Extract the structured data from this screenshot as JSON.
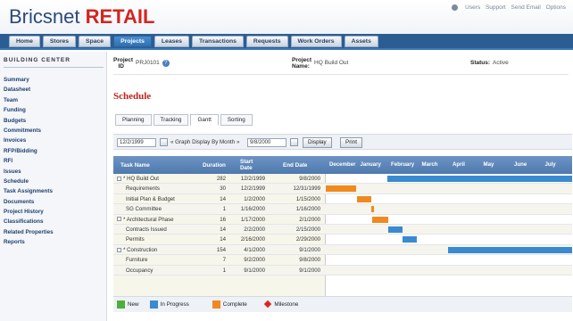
{
  "app": {
    "logo_part1": "Bricsnet",
    "logo_part2": "RETAIL",
    "top_links": [
      "Users",
      "Support",
      "Send Email",
      "Options"
    ]
  },
  "nav_tabs": [
    {
      "label": "Home",
      "active": false
    },
    {
      "label": "Stores",
      "active": false
    },
    {
      "label": "Space",
      "active": false
    },
    {
      "label": "Projects",
      "active": true
    },
    {
      "label": "Leases",
      "active": false
    },
    {
      "label": "Transactions",
      "active": false
    },
    {
      "label": "Requests",
      "active": false
    },
    {
      "label": "Work Orders",
      "active": false
    },
    {
      "label": "Assets",
      "active": false
    }
  ],
  "sidebar": {
    "title": "BUILDING CENTER",
    "items": [
      "Summary",
      "Datasheet",
      "Team",
      "Funding",
      "Budgets",
      "Commitments",
      "Invoices",
      "RFP/Bidding",
      "RFI",
      "Issues",
      "Schedule",
      "Task Assignments",
      "Documents",
      "Project History",
      "Classifications",
      "Related Properties",
      "Reports"
    ]
  },
  "project": {
    "id_label_1": "Project",
    "id_label_2": "ID",
    "id_value": "PRJ0101",
    "name_label_1": "Project",
    "name_label_2": "Name:",
    "name_value": "HQ Build Out",
    "status_label": "Status:",
    "status_value": "Active"
  },
  "schedule": {
    "title": "Schedule",
    "view_tabs": [
      {
        "label": "Planning",
        "active": false
      },
      {
        "label": "Tracking",
        "active": false
      },
      {
        "label": "Gantt",
        "active": true
      },
      {
        "label": "Sorting",
        "active": false
      }
    ],
    "controls": {
      "start_date": "12/2/1999",
      "graph_label": "« Graph Display By Month »",
      "end_date": "9/8/2000",
      "display_button": "Display",
      "print_button": "Print"
    },
    "columns": {
      "task_name": "Task Name",
      "duration": "Duration",
      "start_date": "Start Date",
      "end_date": "End Date"
    },
    "months": [
      "December",
      "January",
      "February",
      "March",
      "April",
      "May",
      "June",
      "July"
    ],
    "tasks": [
      {
        "name": "HQ Build Out",
        "prefix": "* ",
        "indent": 0,
        "duration": "282",
        "start": "12/2/1999",
        "end": "9/8/2000",
        "status": "in_progress",
        "bar_start_day": 61,
        "bar_days": 220
      },
      {
        "name": "Requirements",
        "prefix": "",
        "indent": 1,
        "duration": "30",
        "start": "12/2/1999",
        "end": "12/31/1999",
        "status": "complete",
        "bar_start_day": 0,
        "bar_days": 30
      },
      {
        "name": "Initial Plan & Budget",
        "prefix": "",
        "indent": 1,
        "duration": "14",
        "start": "1/2/2000",
        "end": "1/15/2000",
        "status": "complete",
        "bar_start_day": 31,
        "bar_days": 14
      },
      {
        "name": "SG Committee",
        "prefix": "",
        "indent": 1,
        "duration": "1",
        "start": "1/16/2000",
        "end": "1/16/2000",
        "status": "complete",
        "bar_start_day": 45,
        "bar_days": 1
      },
      {
        "name": "Architectural Phase",
        "prefix": "* ",
        "indent": 0,
        "duration": "16",
        "start": "1/17/2000",
        "end": "2/1/2000",
        "status": "complete",
        "bar_start_day": 46,
        "bar_days": 16
      },
      {
        "name": "Contracts Issued",
        "prefix": "",
        "indent": 1,
        "duration": "14",
        "start": "2/2/2000",
        "end": "2/15/2000",
        "status": "in_progress",
        "bar_start_day": 62,
        "bar_days": 14
      },
      {
        "name": "Permits",
        "prefix": "",
        "indent": 1,
        "duration": "14",
        "start": "2/16/2000",
        "end": "2/29/2000",
        "status": "in_progress",
        "bar_start_day": 76,
        "bar_days": 14
      },
      {
        "name": "Construction",
        "prefix": "* ",
        "indent": 0,
        "duration": "154",
        "start": "4/1/2000",
        "end": "9/1/2000",
        "status": "in_progress",
        "bar_start_day": 121,
        "bar_days": 160
      },
      {
        "name": "Furniture",
        "prefix": "",
        "indent": 1,
        "duration": "7",
        "start": "9/2/2000",
        "end": "9/8/2000",
        "status": "new",
        "bar_start_day": 0,
        "bar_days": 0
      },
      {
        "name": "Occupancy",
        "prefix": "",
        "indent": 1,
        "duration": "1",
        "start": "9/1/2000",
        "end": "9/1/2000",
        "status": "new",
        "bar_start_day": 0,
        "bar_days": 0
      }
    ],
    "legend": [
      {
        "label": "New",
        "kind": "box",
        "color": "#4caf3a"
      },
      {
        "label": "In Progress",
        "kind": "box",
        "color": "#3a8ad0"
      },
      {
        "label": "Complete",
        "kind": "box",
        "color": "#f08a1e"
      },
      {
        "label": "Milestone",
        "kind": "diamond",
        "color": "#d8281f"
      }
    ]
  },
  "colors": {
    "in_progress": "#3a8ad0",
    "complete": "#f08a1e",
    "new": "#4caf3a",
    "brand_red": "#d2261f",
    "brand_blue": "#2b4a7a"
  }
}
